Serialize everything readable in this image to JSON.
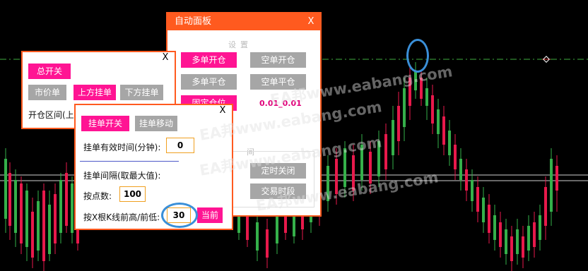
{
  "auto_panel": {
    "title": "自动面板",
    "close": "X",
    "section_settings": "设置",
    "btn_buy_open": "多单开仓",
    "btn_sell_open": "空单开仓",
    "btn_buy_close": "多单平仓",
    "btn_sell_close": "空单平仓",
    "btn_fixed_lot": "固定仓位",
    "lot_value": "0.01_0.01",
    "section_hidden_suffix": "间",
    "btn_timer_close": "定时关闭",
    "btn_trade_session": "交易时段"
  },
  "main_panel": {
    "close": "X",
    "btn_master_switch": "总开关",
    "btn_market_order": "市价单",
    "btn_buy_stop_above": "上方挂单",
    "btn_sell_below": "下方挂单",
    "range_label": "开仓区间(上"
  },
  "pending_panel": {
    "close": "X",
    "btn_pending_switch": "挂单开关",
    "btn_pending_move": "挂单移动",
    "valid_time_label": "挂单有效时间(分钟):",
    "valid_time_value": "0",
    "interval_label": "挂单间隔(取最大值):",
    "points_label": "按点数:",
    "points_value": "100",
    "kline_label": "按X根K线前高/前低:",
    "kline_value": "30",
    "btn_current": "当前"
  },
  "watermark": "EA邦www.eabang.com",
  "colors": {
    "accent": "#ff5a1f",
    "pink_button": "#ff1493",
    "gray_button": "#a6a6a6",
    "bull_candle": "#35b04a",
    "bear_candle": "#e8194b",
    "highlight_ring": "#3a8fd8",
    "dashed_level": "#3fae3f"
  }
}
